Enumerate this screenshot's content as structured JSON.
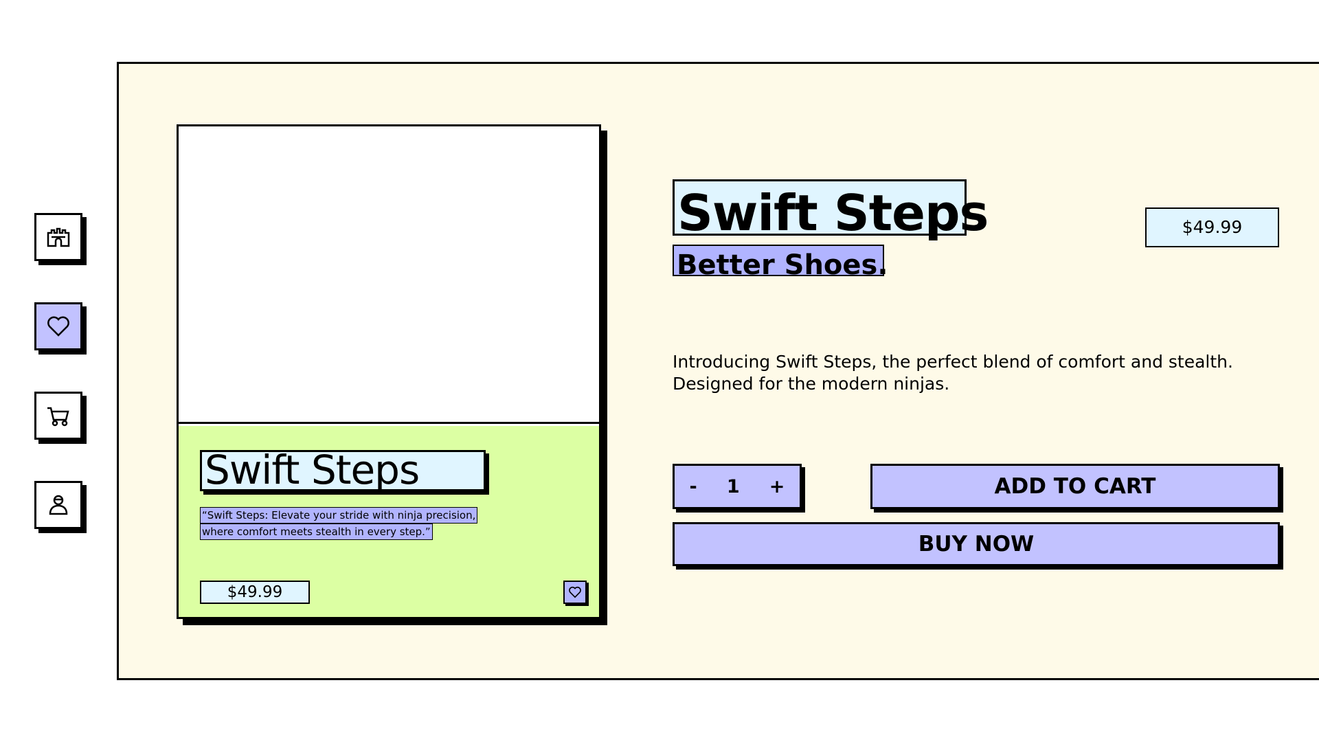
{
  "sidebar": {
    "items": [
      {
        "icon": "castle-icon",
        "active": false
      },
      {
        "icon": "heart-icon",
        "active": true
      },
      {
        "icon": "cart-icon",
        "active": false
      },
      {
        "icon": "ninja-profile-icon",
        "active": false
      }
    ]
  },
  "card": {
    "title": "Swift Steps",
    "quote_line1": "“Swift Steps: Elevate your stride with ninja precision,",
    "quote_line2": "where comfort meets stealth in every step.”",
    "price": "$49.99",
    "favorite_icon": "heart-icon"
  },
  "product": {
    "title": "Swift Steps",
    "subtitle": "Better Shoes.",
    "price": "$49.99",
    "description": "Introducing Swift Steps, the perfect blend of comfort and stealth. Designed for the modern ninjas."
  },
  "quantity": {
    "minus_label": "-",
    "value": "1",
    "plus_label": "+"
  },
  "actions": {
    "add_to_cart_label": "ADD TO CART",
    "buy_now_label": "BUY NOW"
  },
  "colors": {
    "panel_bg": "#fefae8",
    "lavender": "#c2c2ff",
    "light_cyan": "#e0f5ff",
    "lime": "#dcffa3"
  }
}
